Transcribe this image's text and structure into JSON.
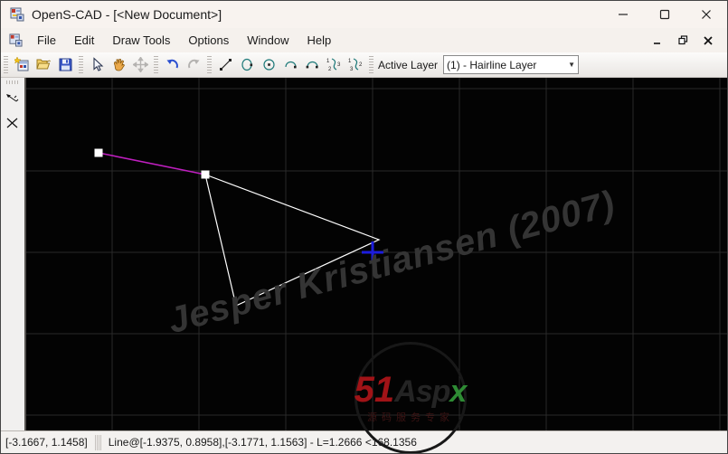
{
  "window": {
    "title": "OpenS-CAD - [<New Document>]"
  },
  "menu": {
    "items": [
      "File",
      "Edit",
      "Draw Tools",
      "Options",
      "Window",
      "Help"
    ]
  },
  "toolbar": {
    "buttons": [
      "new-document",
      "open-file",
      "save",
      "select",
      "pan",
      "move",
      "undo",
      "redo",
      "line",
      "ellipse",
      "circle-center",
      "arc",
      "arc-endpoints",
      "curve-3-point",
      "curve-2-point"
    ],
    "active_layer_label": "Active Layer",
    "layer_value": "(1) - Hairline Layer"
  },
  "side_toolbar": {
    "buttons": [
      "measure-line",
      "delete-cross"
    ]
  },
  "canvas": {
    "watermark_text": "Jesper Kristiansen (2007)",
    "logo": {
      "part_51": "51",
      "part_asp": "Asp",
      "part_x": "x",
      "subtext": "源码服务专家"
    },
    "colors": {
      "background": "#030303",
      "grid": "#2a2a2a",
      "selected_line": "#bf1fbf",
      "shape_line": "#ffffff",
      "snap_cursor": "#1c1cdd"
    }
  },
  "statusbar": {
    "cursor_position": "[-3.1667, 1.1458]",
    "selection_info": "Line@[-1.9375, 0.8958],[-3.1771, 1.1563] - L=1.2666 <168.1356"
  }
}
